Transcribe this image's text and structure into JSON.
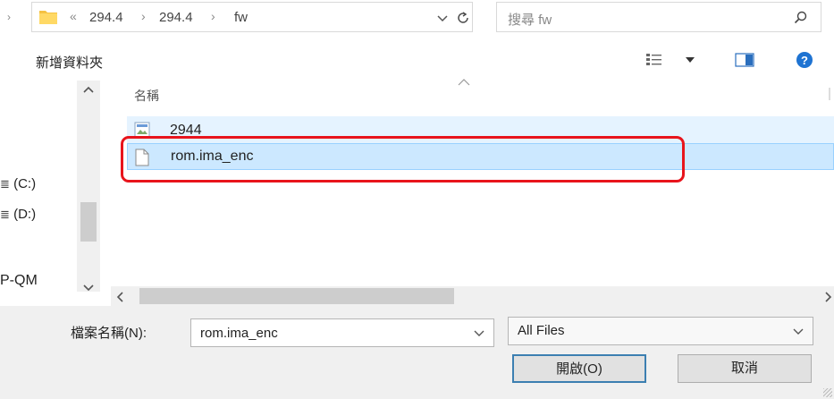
{
  "address": {
    "back_prefix": "«",
    "crumbs": [
      "294.4",
      "294.4",
      "fw"
    ],
    "separator": "›"
  },
  "search": {
    "placeholder": "搜尋 fw"
  },
  "toolbar": {
    "new_folder": "新增資料夾"
  },
  "nav": {
    "items": [
      "(C:)",
      "(D:)",
      "P-QM"
    ]
  },
  "filelist": {
    "column_name": "名稱",
    "files": [
      {
        "name": "2944",
        "icon": "image-file-icon"
      },
      {
        "name": "rom.ima_enc",
        "icon": "file-icon",
        "selected": true
      }
    ]
  },
  "bottom": {
    "filename_label": "檔案名稱(N):",
    "filename_value": "rom.ima_enc",
    "filetype_value": "All Files",
    "open_label": "開啟(O)",
    "cancel_label": "取消"
  },
  "colors": {
    "selection": "#cce8ff",
    "highlight": "#e8141c",
    "help": "#1e73d2"
  }
}
